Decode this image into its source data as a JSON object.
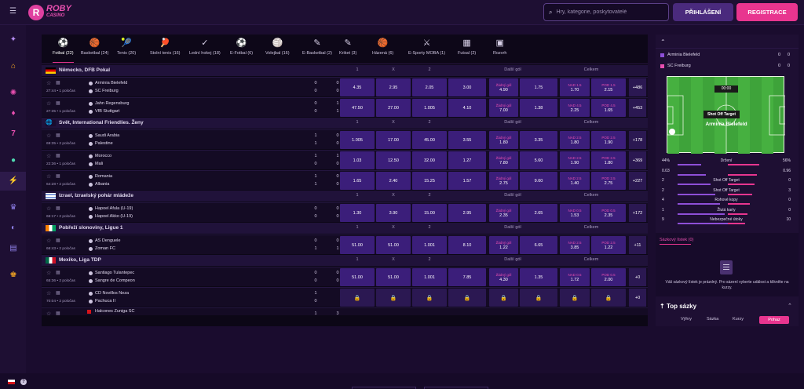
{
  "header": {
    "logo_top": "ROBY",
    "logo_bottom": "CASINO",
    "search_placeholder": "Hry, kategorie, poskytovatelé",
    "login_label": "PŘIHLÁŠENÍ",
    "register_label": "REGISTRACE"
  },
  "sidebar": {
    "icons": [
      "menu-icon",
      "gift-icon",
      "home-icon",
      "casino-chip-icon",
      "microphone-icon",
      "seven-icon",
      "ball-icon",
      "lightning-icon",
      "trophy-icon",
      "rocket-icon",
      "cart-icon",
      "crown-icon"
    ]
  },
  "sports_tabs": [
    {
      "label": "Fotbal (22)",
      "icon": "⚽"
    },
    {
      "label": "Basketbal (24)",
      "icon": "🏀"
    },
    {
      "label": "Tenis (20)",
      "icon": "🎾"
    },
    {
      "label": "Stolní tenis (16)",
      "icon": "🏓"
    },
    {
      "label": "Lední hokej (18)",
      "icon": "✓"
    },
    {
      "label": "E-Fotbal (6)",
      "icon": "⚽"
    },
    {
      "label": "Volejbal (16)",
      "icon": "🏐"
    },
    {
      "label": "E-Basketbal (2)",
      "icon": "✎"
    },
    {
      "label": "Kriket (3)",
      "icon": "✎"
    },
    {
      "label": "Házená (6)",
      "icon": "🏀"
    },
    {
      "label": "E-Sporty MOBA (1)",
      "icon": "⚔"
    },
    {
      "label": "Futsal (2)",
      "icon": "▦"
    },
    {
      "label": "Rozvrh",
      "icon": "▣"
    }
  ],
  "col_headers": {
    "h1": "1",
    "hx": "X",
    "h2": "2",
    "dalsi": "Další gól",
    "celkem": "Celkem"
  },
  "leagues": [
    {
      "name": "Německo, DFB Pokal",
      "events": [
        {
          "time": "27:44 • 1 poločas",
          "t1": "Arminia Bielefeld",
          "t2": "SC Freiburg",
          "s1a": "0",
          "s1b": "0",
          "s2a": "0",
          "s2b": "0",
          "o1": "4.35",
          "ox": "2.95",
          "o2": "2.05",
          "d1": "3.00",
          "dl": "Žádný gól",
          "dv": "4.90",
          "d3": "1.75",
          "cl": "NAD 1.5",
          "cv": "1.70",
          "pl": "POD 1.5",
          "pv": "2.15",
          "more": "+486"
        },
        {
          "time": "27:35 • 1 poločas",
          "t1": "Jahn Regensburg",
          "t2": "VfB Stuttgart",
          "s1a": "0",
          "s1b": "0",
          "s2a": "1",
          "s2b": "1",
          "o1": "47.50",
          "ox": "27.00",
          "o2": "1.005",
          "d1": "4.10",
          "dl": "Žádný gól",
          "dv": "7.00",
          "d3": "1.38",
          "cl": "NAD 4.5",
          "cv": "2.25",
          "pl": "POD 4.5",
          "pv": "1.65",
          "more": "+453"
        }
      ]
    },
    {
      "name": "Svět, International Friendlies. Ženy",
      "events": [
        {
          "time": "69:35 • 2 poločas",
          "t1": "Saudi Arabia",
          "t2": "Palestine",
          "s1a": "1",
          "s1b": "1",
          "s2a": "0",
          "s2b": "0",
          "s3a": "2",
          "s3b": "0",
          "o1": "1.005",
          "ox": "17.00",
          "o2": "45.00",
          "d1": "3.55",
          "dl": "Žádný gól",
          "dv": "1.80",
          "d3": "3.35",
          "cl": "NAD 2.5",
          "cv": "1.80",
          "pl": "POD 2.5",
          "pv": "1.90",
          "more": "+178"
        },
        {
          "time": "22:36 • 1 poločas",
          "t1": "Morocco",
          "t2": "Mali",
          "s1a": "1",
          "s1b": "0",
          "s2a": "1",
          "s2b": "0",
          "o1": "1.03",
          "ox": "12.50",
          "o2": "32.00",
          "d1": "1.27",
          "dl": "Žádný gól",
          "dv": "7.80",
          "d3": "5.60",
          "cl": "NAD 2.5",
          "cv": "1.90",
          "pl": "POD 2.5",
          "pv": "1.80",
          "more": "+369"
        },
        {
          "time": "64:28 • 2 poločas",
          "t1": "Romania",
          "t2": "Albania",
          "s1a": "1",
          "s1b": "1",
          "s2a": "0",
          "s2b": "0",
          "s3a": "2",
          "s3b": "0",
          "o1": "1.65",
          "ox": "2.40",
          "o2": "15.25",
          "d1": "1.57",
          "dl": "Žádný gól",
          "dv": "2.75",
          "d3": "9.60",
          "cl": "NAD 2.5",
          "cv": "1.40",
          "pl": "POD 2.5",
          "pv": "2.75",
          "more": "+227"
        }
      ]
    },
    {
      "name": "Izrael, Izraelský pohár mládeže",
      "events": [
        {
          "time": "66:17 • 2 poločas",
          "t1": "Hapoel Afula (U-19)",
          "t2": "Hapoel Akko (U-19)",
          "s1a": "0",
          "s1b": "0",
          "s2a": "0",
          "s2b": "0",
          "s3a": "0",
          "s3b": "0",
          "o1": "1.30",
          "ox": "3.90",
          "o2": "15.00",
          "d1": "2.95",
          "dl": "Žádný gól",
          "dv": "2.35",
          "d3": "2.65",
          "cl": "NAD 0.5",
          "cv": "1.53",
          "pl": "POD 0.5",
          "pv": "2.35",
          "more": "+172"
        }
      ]
    },
    {
      "name": "Pobřeží slonoviny, Ligue 1",
      "events": [
        {
          "time": "66:43 • 2 poločas",
          "t1": "AS Denguele",
          "t2": "Zoman FC",
          "s1a": "0",
          "s1b": "1",
          "s2a": "0",
          "s2b": "1",
          "s3a": "0",
          "s3b": "2",
          "o1": "51.00",
          "ox": "51.00",
          "o2": "1.001",
          "d1": "8.10",
          "dl": "Žádný gól",
          "dv": "1.22",
          "d3": "6.65",
          "cl": "NAD 2.5",
          "cv": "3.85",
          "pl": "POD 2.5",
          "pv": "1.22",
          "more": "+11"
        }
      ]
    },
    {
      "name": "Mexiko, Liga TDP",
      "events": [
        {
          "time": "65:36 • 2 poločas",
          "t1": "Santiago Tulantepec",
          "t2": "Sangre de Compeon",
          "s1a": "0",
          "s1b": "0",
          "s2a": "0",
          "s2b": "0",
          "s3a": "0",
          "s3b": "0",
          "o1": "51.00",
          "ox": "51.00",
          "o2": "1.001",
          "d1": "7.85",
          "dl": "Žádný gól",
          "dv": "4.30",
          "d3": "1.35",
          "cl": "NAD 0.5",
          "cv": "1.72",
          "pl": "POD 0.5",
          "pv": "2.00",
          "more": "+0"
        },
        {
          "time": "70:04 • 2 poločas",
          "t1": "CD Novillos Neza",
          "t2": "Pachuca II",
          "s1a": "1",
          "s1b": "0",
          "s2a": "",
          "s2b": "",
          "s3a": "",
          "s3b": "",
          "locked": true,
          "more": "+0"
        },
        {
          "time": "",
          "t1": "Halcones Zuniga SC",
          "t2": "",
          "s1a": "1",
          "s1b": "",
          "s2a": "3",
          "s2b": "",
          "partial": true,
          "more": ""
        }
      ]
    }
  ],
  "right_panel": {
    "team1": "Arminia Bielefeld",
    "team2": "SC Freiburg",
    "team1_score": [
      "0",
      "0"
    ],
    "team2_score": [
      "0",
      "0"
    ],
    "pitch_timer": "00:00",
    "pitch_event": "Shot Off Target",
    "pitch_team": "Arminia Bielefeld",
    "stats": [
      {
        "l": "44%",
        "c": "Držení",
        "r": "56%"
      },
      {
        "l": "0.03",
        "c": "",
        "r": "0.96"
      },
      {
        "l": "2",
        "c": "Shot Off Target",
        "r": "0"
      },
      {
        "l": "2",
        "c": "Shot Off Target",
        "r": "3"
      },
      {
        "l": "4",
        "c": "Rohové kopy",
        "r": "0"
      },
      {
        "l": "1",
        "c": "Žlutá karty",
        "r": "0"
      },
      {
        "l": "9",
        "c": "Nebezpečné útoky",
        "r": "10"
      }
    ],
    "slip_tab": "Sázkový lístek (0)",
    "slip_text": "Váš sázkový lístek je prázdný. Pro sázení vyberte událost a klikněte na kurzy.",
    "top_sazky": "Top sázky",
    "top_tabs": [
      "Výhry",
      "Sázka",
      "Kurzy",
      "Pohaz"
    ]
  },
  "colors": {
    "accent": "#e8358f",
    "odd_bg": "#3b1e7a",
    "page_bg": "#1a0c2e"
  }
}
